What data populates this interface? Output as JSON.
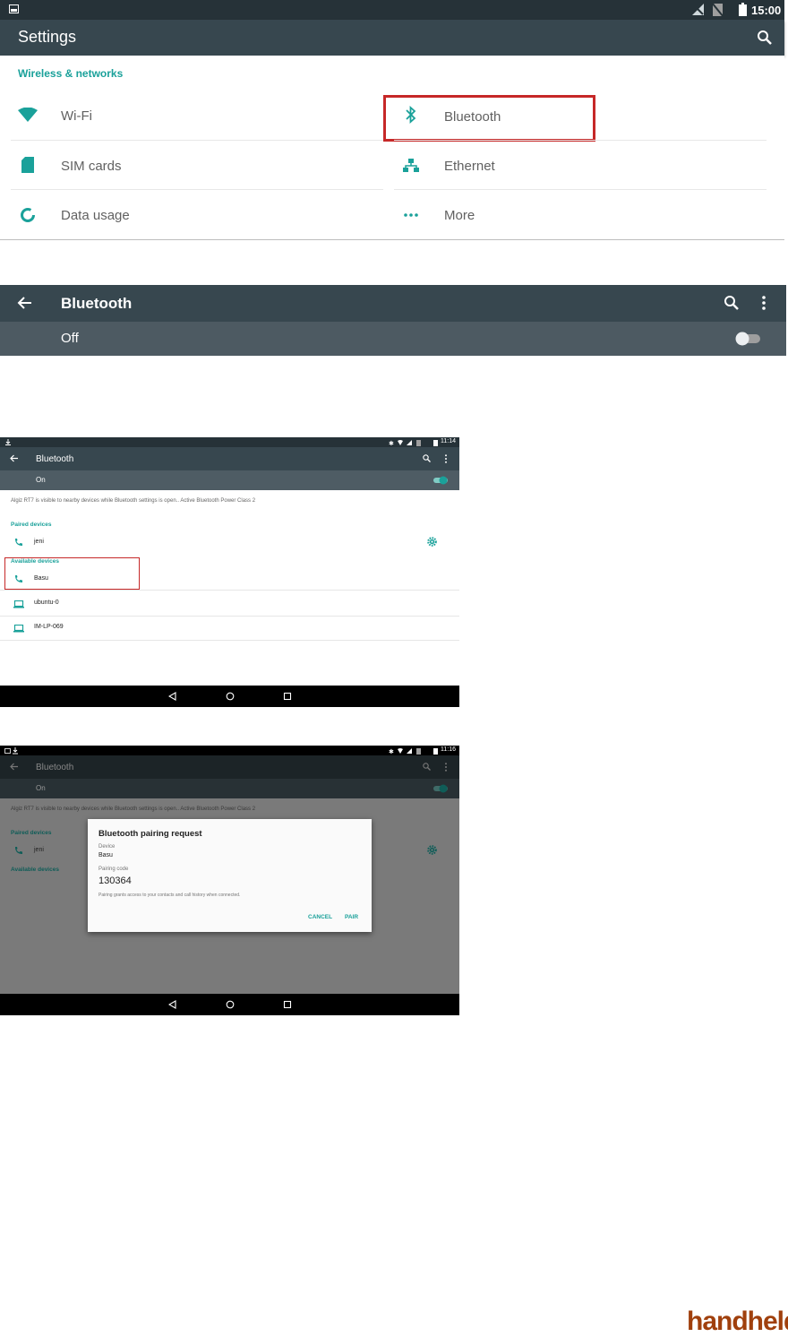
{
  "screen1": {
    "status_time": "15:00",
    "title": "Settings",
    "section_header": "Wireless & networks",
    "tiles": [
      {
        "label": "Wi-Fi",
        "icon": "wifi-icon"
      },
      {
        "label": "Bluetooth",
        "icon": "bluetooth-icon"
      },
      {
        "label": "SIM cards",
        "icon": "sim-card-icon"
      },
      {
        "label": "Ethernet",
        "icon": "ethernet-icon"
      },
      {
        "label": "Data usage",
        "icon": "data-usage-icon"
      },
      {
        "label": "More",
        "icon": "more-dots-icon"
      }
    ]
  },
  "screen2": {
    "title": "Bluetooth",
    "toggle_label": "Off",
    "toggle_on": false
  },
  "screen3": {
    "status_time": "11:14",
    "title": "Bluetooth",
    "toggle_label": "On",
    "toggle_on": true,
    "visibility_text": "Algiz RT7 is visible to nearby devices while Bluetooth settings is open.. Active Bluetooth Power Class 2",
    "paired_header": "Paired devices",
    "paired": [
      {
        "name": "jeni",
        "icon": "phone-icon"
      }
    ],
    "available_header": "Available devices",
    "available": [
      {
        "name": "Basu",
        "icon": "phone-icon"
      },
      {
        "name": "ubuntu-0",
        "icon": "laptop-icon"
      },
      {
        "name": "IM-LP-069",
        "icon": "laptop-icon"
      }
    ]
  },
  "screen4": {
    "status_time": "11:16",
    "title": "Bluetooth",
    "toggle_label": "On",
    "visibility_text": "Algiz RT7 is visible to nearby devices while Bluetooth settings is open.. Active Bluetooth Power Class 2",
    "paired_header": "Paired devices",
    "paired": [
      {
        "name": "jeni"
      }
    ],
    "available_header": "Available devices",
    "dialog": {
      "title": "Bluetooth pairing request",
      "device_label": "Device",
      "device_value": "Basu",
      "code_label": "Pairing code",
      "code_value": "130364",
      "note": "Pairing grants access to your contacts and call history when connected.",
      "cancel_label": "CANCEL",
      "pair_label": "PAIR"
    }
  },
  "brand": {
    "watermark": "handheld"
  },
  "colors": {
    "accent": "#1aa19a",
    "appbar": "#37474f",
    "statusbar": "#263238",
    "highlight": "#c62828"
  }
}
